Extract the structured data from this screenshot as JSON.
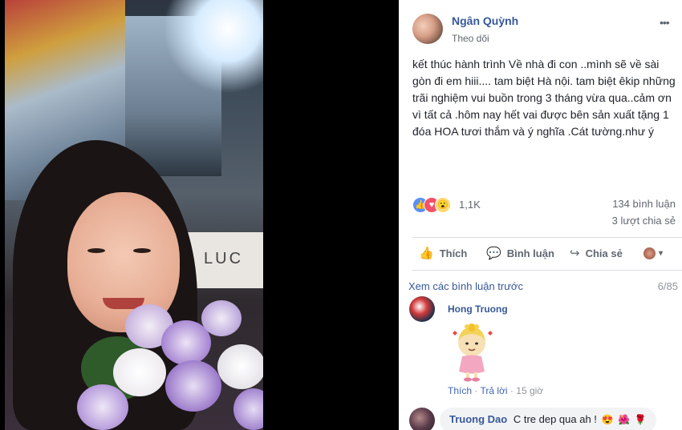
{
  "post": {
    "author": "Ngân Quỳnh",
    "follow_label": "Theo dõi",
    "more_label": "•••",
    "text": "kết thúc hành trình Về nhà đi con ..mình sẽ về sài gòn đi em hiii.... tam biệt Hà nội. tam biệt êkip những trãi nghiệm vui buồn trong 3 tháng vừa qua..cảm ơn vì tất cả .hôm nay hết vai được bên sản xuất tặng 1 đóa HOA tươi thắm và ý nghĩa .Cát tường.như ý"
  },
  "photo": {
    "sign_text": "LUC"
  },
  "reactions": {
    "count": "1,1K",
    "like_icon": "👍",
    "love_icon": "♥",
    "wow_icon": "😮",
    "comments": "134 bình luận",
    "shares": "3 lượt chia sẻ"
  },
  "actions": {
    "like": "Thích",
    "comment": "Bình luận",
    "share": "Chia sẻ",
    "like_icon": "👍",
    "comment_icon": "💬",
    "share_icon": "↪",
    "caret": "▾"
  },
  "comments": {
    "view_previous": "Xem các bình luận trước",
    "page_count": "6/85",
    "items": [
      {
        "author": "Hong Truong",
        "sticker": "sticker-girl-with-flower",
        "like_label": "Thích",
        "reply_label": "Trả lời",
        "time": "15 giờ"
      },
      {
        "author": "Truong Dao",
        "text": "C tre dep qua ah !",
        "emojis": [
          "😍",
          "🌺",
          "🌹"
        ]
      }
    ]
  },
  "colors": {
    "link_blue": "#365899",
    "meta_gray": "#90949c",
    "text_dark": "#1d2129",
    "border": "#dadde1",
    "bubble_bg": "#f2f3f5"
  }
}
